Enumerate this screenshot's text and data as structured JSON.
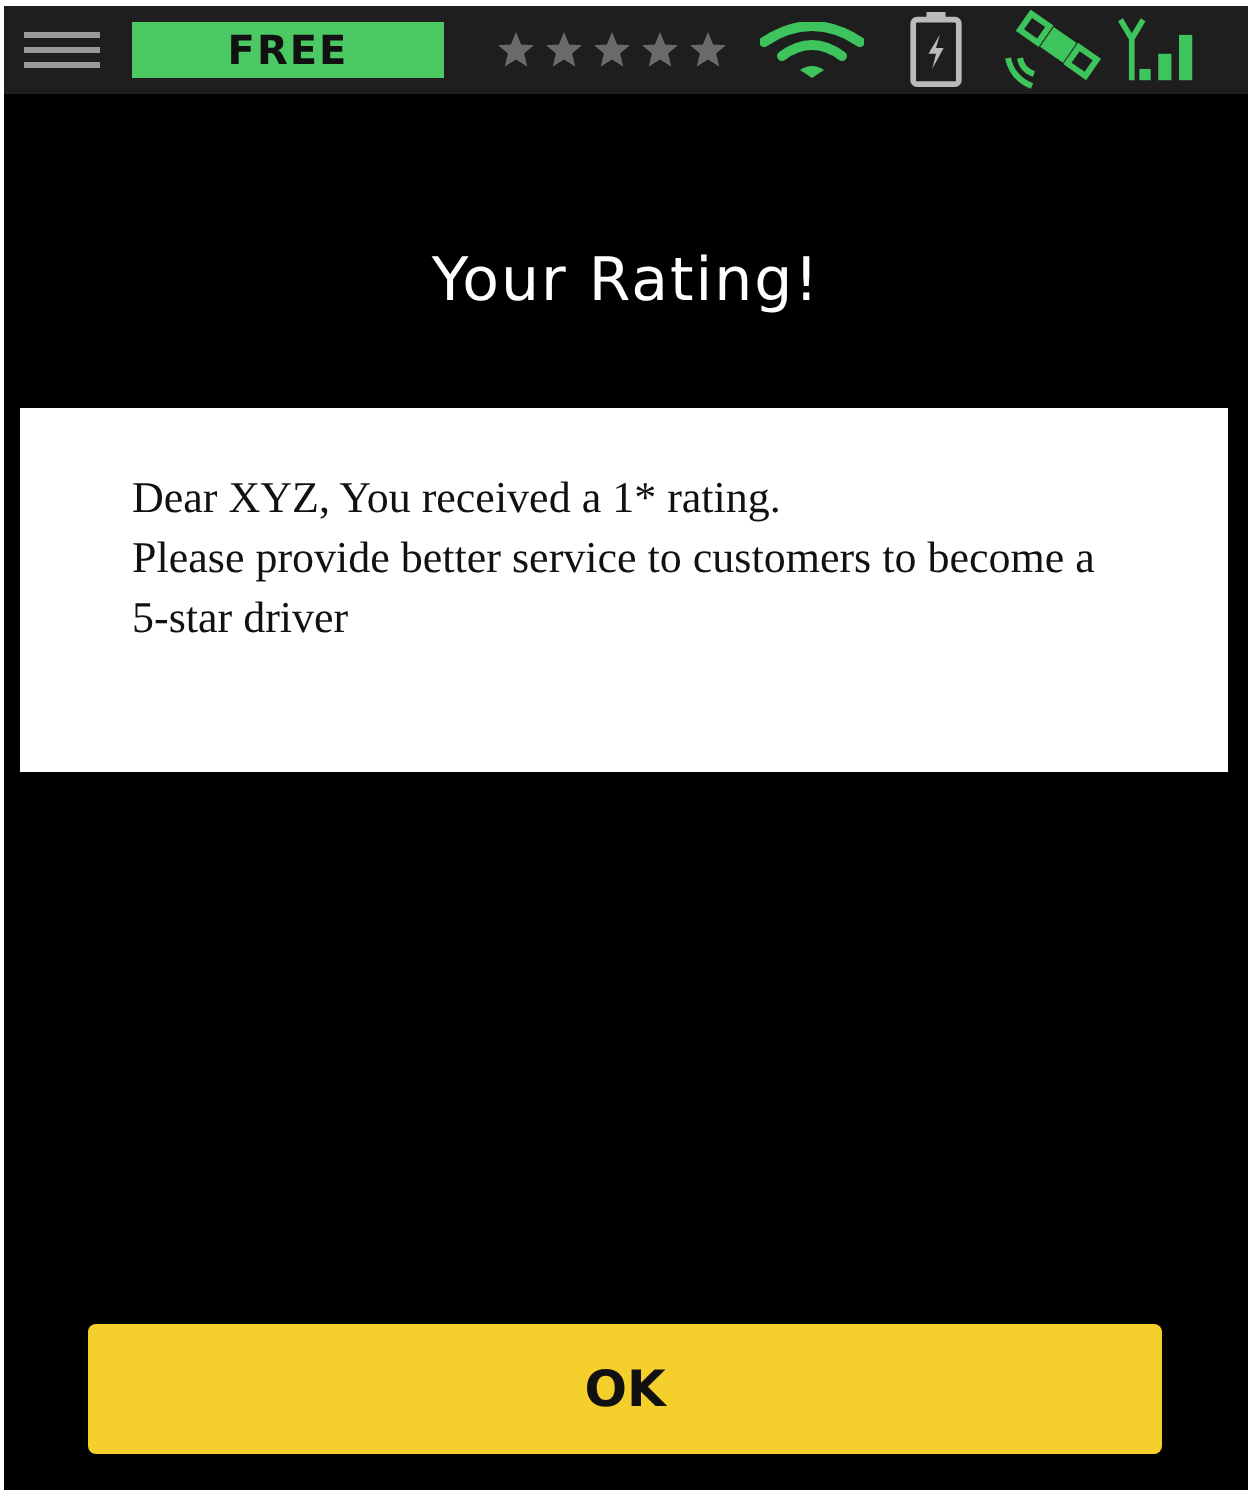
{
  "status_bar": {
    "badge": "FREE",
    "stars": 0
  },
  "title": "Your Rating!",
  "message": [
    "Dear XYZ, You received a 1* rating.",
    "Please provide better service to customers to become a 5-star driver"
  ],
  "ok_button": "OK"
}
